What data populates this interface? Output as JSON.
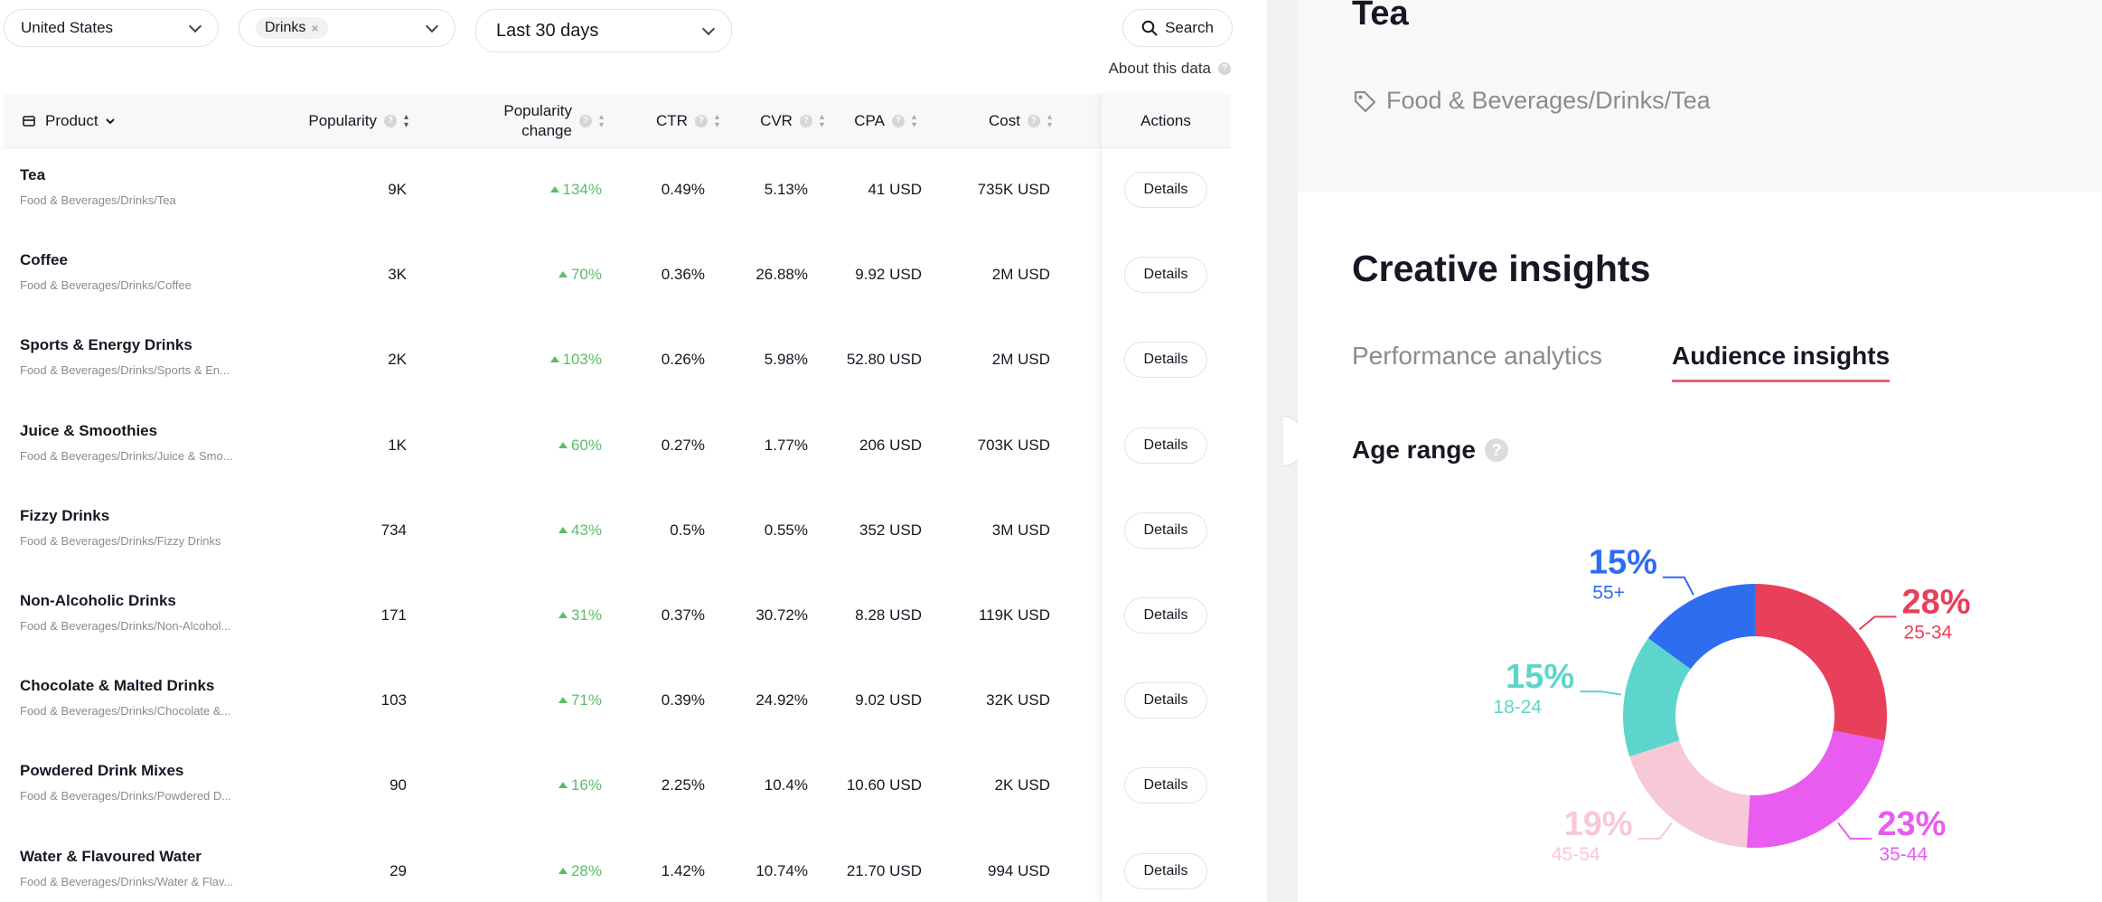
{
  "filters": {
    "country": "United States",
    "category_chip": "Drinks",
    "category_chip_remove": "×",
    "date_range": "Last 30 days"
  },
  "search": {
    "label": "Search"
  },
  "about": {
    "label": "About this data"
  },
  "table": {
    "headers": {
      "product": "Product",
      "popularity": "Popularity",
      "popularity_change_1": "Popularity",
      "popularity_change_2": "change",
      "ctr": "CTR",
      "cvr": "CVR",
      "cpa": "CPA",
      "cost": "Cost",
      "actions": "Actions"
    },
    "details_label": "Details",
    "rows": [
      {
        "name": "Tea",
        "path": "Food & Beverages/Drinks/Tea",
        "popularity": "9K",
        "change": "134%",
        "ctr": "0.49%",
        "cvr": "5.13%",
        "cpa": "41 USD",
        "cost": "735K USD"
      },
      {
        "name": "Coffee",
        "path": "Food & Beverages/Drinks/Coffee",
        "popularity": "3K",
        "change": "70%",
        "ctr": "0.36%",
        "cvr": "26.88%",
        "cpa": "9.92 USD",
        "cost": "2M USD"
      },
      {
        "name": "Sports & Energy Drinks",
        "path": "Food & Beverages/Drinks/Sports & En...",
        "popularity": "2K",
        "change": "103%",
        "ctr": "0.26%",
        "cvr": "5.98%",
        "cpa": "52.80 USD",
        "cost": "2M USD"
      },
      {
        "name": "Juice & Smoothies",
        "path": "Food & Beverages/Drinks/Juice & Smo...",
        "popularity": "1K",
        "change": "60%",
        "ctr": "0.27%",
        "cvr": "1.77%",
        "cpa": "206 USD",
        "cost": "703K USD"
      },
      {
        "name": "Fizzy Drinks",
        "path": "Food & Beverages/Drinks/Fizzy Drinks",
        "popularity": "734",
        "change": "43%",
        "ctr": "0.5%",
        "cvr": "0.55%",
        "cpa": "352 USD",
        "cost": "3M USD"
      },
      {
        "name": "Non-Alcoholic Drinks",
        "path": "Food & Beverages/Drinks/Non-Alcohol...",
        "popularity": "171",
        "change": "31%",
        "ctr": "0.37%",
        "cvr": "30.72%",
        "cpa": "8.28 USD",
        "cost": "119K USD"
      },
      {
        "name": "Chocolate & Malted Drinks",
        "path": "Food & Beverages/Drinks/Chocolate &...",
        "popularity": "103",
        "change": "71%",
        "ctr": "0.39%",
        "cvr": "24.92%",
        "cpa": "9.02 USD",
        "cost": "32K USD"
      },
      {
        "name": "Powdered Drink Mixes",
        "path": "Food & Beverages/Drinks/Powdered D...",
        "popularity": "90",
        "change": "16%",
        "ctr": "2.25%",
        "cvr": "10.4%",
        "cpa": "10.60 USD",
        "cost": "2K USD"
      },
      {
        "name": "Water & Flavoured Water",
        "path": "Food & Beverages/Drinks/Water & Flav...",
        "popularity": "29",
        "change": "28%",
        "ctr": "1.42%",
        "cvr": "10.74%",
        "cpa": "21.70 USD",
        "cost": "994 USD"
      }
    ]
  },
  "detail": {
    "title": "Tea",
    "path": "Food & Beverages/Drinks/Tea",
    "section_title": "Creative insights",
    "tabs": [
      {
        "label": "Performance analytics",
        "active": false
      },
      {
        "label": "Audience insights",
        "active": true
      }
    ],
    "age_range_title": "Age range"
  },
  "chart_data": {
    "type": "pie",
    "donut": true,
    "title": "Age range",
    "slices": [
      {
        "label": "25-34",
        "value": 28,
        "display": "28%",
        "color": "#e8405a"
      },
      {
        "label": "35-44",
        "value": 23,
        "display": "23%",
        "color": "#e85cf0"
      },
      {
        "label": "45-54",
        "value": 19,
        "display": "19%",
        "color": "#f7c9d7"
      },
      {
        "label": "18-24",
        "value": 15,
        "display": "15%",
        "color": "#5cd6cc"
      },
      {
        "label": "55+",
        "value": 15,
        "display": "15%",
        "color": "#2e6df0"
      }
    ]
  },
  "colors": {
    "accent_tab_underline": "#e8607a",
    "positive_change": "#5bbd6a"
  }
}
